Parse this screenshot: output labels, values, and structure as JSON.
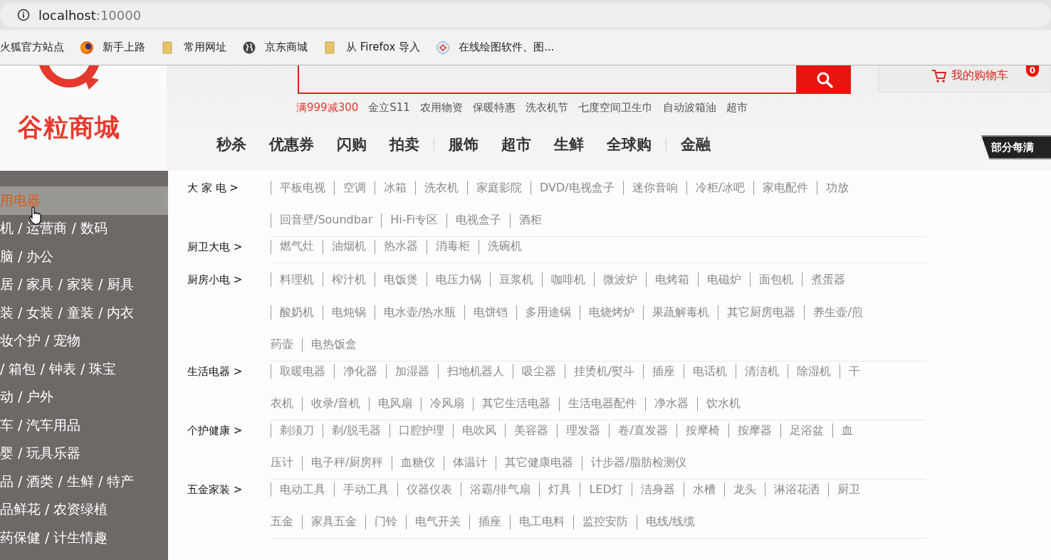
{
  "browser": {
    "url_host": "localhost",
    "url_port": ":10000",
    "bookmarks": [
      {
        "label": "火狐官方站点",
        "kind": "plain"
      },
      {
        "label": "新手上路",
        "kind": "firefox"
      },
      {
        "label": "常用网址",
        "kind": "folder"
      },
      {
        "label": "京东商城",
        "kind": "globe"
      },
      {
        "label": "从 Firefox 导入",
        "kind": "folder"
      },
      {
        "label": "在线绘图软件、图...",
        "kind": "diagram"
      }
    ]
  },
  "header": {
    "logo_text": "谷粒商城",
    "hot_words": [
      {
        "label": "满999减300",
        "highlighted": true
      },
      {
        "label": "金立S11",
        "highlighted": false
      },
      {
        "label": "农用物资",
        "highlighted": false
      },
      {
        "label": "保暖特惠",
        "highlighted": false
      },
      {
        "label": "洗衣机节",
        "highlighted": false
      },
      {
        "label": "七度空间卫生巾",
        "highlighted": false
      },
      {
        "label": "自动波箱油",
        "highlighted": false
      },
      {
        "label": "超市",
        "highlighted": false
      }
    ],
    "cart": {
      "label": "我的购物车",
      "count": "0"
    },
    "nav": [
      {
        "label": "秒杀",
        "divider_before": false
      },
      {
        "label": "优惠券",
        "divider_before": false
      },
      {
        "label": "闪购",
        "divider_before": false
      },
      {
        "label": "拍卖",
        "divider_before": false
      },
      {
        "label": "服饰",
        "divider_before": true
      },
      {
        "label": "超市",
        "divider_before": false
      },
      {
        "label": "生鲜",
        "divider_before": false
      },
      {
        "label": "全球购",
        "divider_before": false
      },
      {
        "label": "金融",
        "divider_before": true
      }
    ],
    "promo_tag": "部分每满"
  },
  "sidebar": {
    "items": [
      {
        "label": "用电器",
        "selected": true
      },
      {
        "label": "机 / 运营商 / 数码",
        "selected": false
      },
      {
        "label": "脑 / 办公",
        "selected": false
      },
      {
        "label": "居 / 家具 / 家装 / 厨具",
        "selected": false
      },
      {
        "label": "装 / 女装 / 童装 / 内衣",
        "selected": false
      },
      {
        "label": "妆个护 / 宠物",
        "selected": false
      },
      {
        "label": "/ 箱包 / 钟表 / 珠宝",
        "selected": false
      },
      {
        "label": "动 / 户外",
        "selected": false
      },
      {
        "label": "车 / 汽车用品",
        "selected": false
      },
      {
        "label": "婴 / 玩具乐器",
        "selected": false
      },
      {
        "label": "品 / 酒类 / 生鲜 / 特产",
        "selected": false
      },
      {
        "label": "品鲜花 / 农资绿植",
        "selected": false
      },
      {
        "label": "药保健 / 计生情趣",
        "selected": false
      }
    ]
  },
  "categories": [
    {
      "label": "大 家 电 >",
      "lines": [
        {
          "continued": false,
          "items": [
            "平板电视",
            "空调",
            "冰箱",
            "洗衣机",
            "家庭影院",
            "DVD/电视盒子",
            "迷你音响",
            "冷柜/冰吧",
            "家电配件",
            "功放"
          ]
        },
        {
          "continued": false,
          "items": [
            "回音壁/Soundbar",
            "Hi-Fi专区",
            "电视盒子",
            "酒柜"
          ]
        }
      ]
    },
    {
      "label": "厨卫大电 >",
      "lines": [
        {
          "continued": false,
          "items": [
            "燃气灶",
            "油烟机",
            "热水器",
            "消毒柜",
            "洗碗机"
          ]
        }
      ]
    },
    {
      "label": "厨房小电 >",
      "lines": [
        {
          "continued": false,
          "items": [
            "料理机",
            "榨汁机",
            "电饭煲",
            "电压力锅",
            "豆浆机",
            "咖啡机",
            "微波炉",
            "电烤箱",
            "电磁炉",
            "面包机",
            "煮蛋器"
          ]
        },
        {
          "continued": false,
          "items": [
            "酸奶机",
            "电炖锅",
            "电水壶/热水瓶",
            "电饼铛",
            "多用途锅",
            "电烧烤炉",
            "果蔬解毒机",
            "其它厨房电器",
            "养生壶/煎"
          ]
        },
        {
          "continued": true,
          "items": [
            "药壶",
            "电热饭盒"
          ]
        }
      ]
    },
    {
      "label": "生活电器 >",
      "lines": [
        {
          "continued": false,
          "items": [
            "取暖电器",
            "净化器",
            "加湿器",
            "扫地机器人",
            "吸尘器",
            "挂烫机/熨斗",
            "插座",
            "电话机",
            "清洁机",
            "除湿机",
            "干"
          ]
        },
        {
          "continued": true,
          "items": [
            "衣机",
            "收录/音机",
            "电风扇",
            "冷风扇",
            "其它生活电器",
            "生活电器配件",
            "净水器",
            "饮水机"
          ]
        }
      ]
    },
    {
      "label": "个护健康 >",
      "lines": [
        {
          "continued": false,
          "items": [
            "剃须刀",
            "剃/脱毛器",
            "口腔护理",
            "电吹风",
            "美容器",
            "理发器",
            "卷/直发器",
            "按摩椅",
            "按摩器",
            "足浴盆",
            "血"
          ]
        },
        {
          "continued": true,
          "items": [
            "压计",
            "电子秤/厨房秤",
            "血糖仪",
            "体温计",
            "其它健康电器",
            "计步器/脂肪检测仪"
          ]
        }
      ]
    },
    {
      "label": "五金家装 >",
      "lines": [
        {
          "continued": false,
          "items": [
            "电动工具",
            "手动工具",
            "仪器仪表",
            "浴霸/排气扇",
            "灯具",
            "LED灯",
            "洁身器",
            "水槽",
            "龙头",
            "淋浴花洒",
            "厨卫"
          ]
        },
        {
          "continued": true,
          "items": [
            "五金",
            "家具五金",
            "门铃",
            "电气开关",
            "插座",
            "电工电料",
            "监控安防",
            "电线/线缆"
          ]
        }
      ]
    }
  ]
}
